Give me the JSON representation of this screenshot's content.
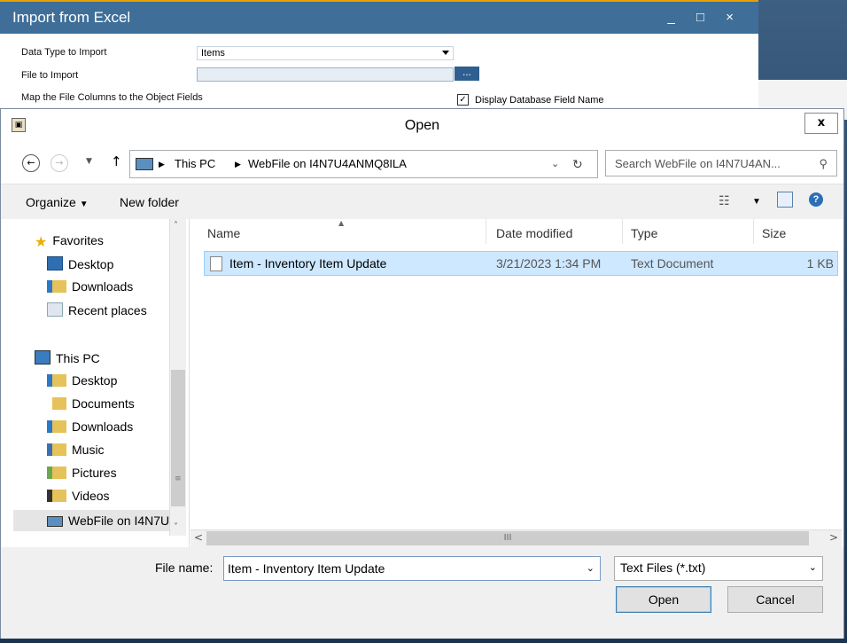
{
  "sap": {
    "title": "Import from Excel",
    "window_buttons": "_ □ ×",
    "data_type_label": "Data Type to Import",
    "data_type_value": "Items",
    "file_label": "File to Import",
    "browse_label": "...",
    "map_label": "Map the File Columns to the Object Fields",
    "display_db_label": "Display Database Field Name",
    "display_db_checked": true
  },
  "dialog": {
    "title": "Open",
    "close_label": "x",
    "breadcrumb": [
      "This PC",
      "WebFile on I4N7U4ANMQ8ILA"
    ],
    "search_placeholder": "Search WebFile on I4N7U4AN...",
    "toolbar": {
      "organize": "Organize",
      "new_folder": "New folder"
    },
    "sidebar": {
      "favorites": [
        {
          "label": "Favorites",
          "icon": "star-icon"
        },
        {
          "label": "Desktop",
          "icon": "desktop-icon"
        },
        {
          "label": "Downloads",
          "icon": "downloads-icon"
        },
        {
          "label": "Recent places",
          "icon": "recent-places-icon"
        }
      ],
      "this_pc": [
        {
          "label": "This PC",
          "icon": "computer-icon"
        },
        {
          "label": "Desktop",
          "icon": "desktop-folder-icon"
        },
        {
          "label": "Documents",
          "icon": "documents-icon"
        },
        {
          "label": "Downloads",
          "icon": "downloads-icon"
        },
        {
          "label": "Music",
          "icon": "music-icon"
        },
        {
          "label": "Pictures",
          "icon": "pictures-icon"
        },
        {
          "label": "Videos",
          "icon": "videos-icon"
        },
        {
          "label": "WebFile on I4N7U",
          "icon": "network-drive-icon"
        }
      ]
    },
    "columns": [
      "Name",
      "Date modified",
      "Type",
      "Size"
    ],
    "files": [
      {
        "name": "Item - Inventory Item Update",
        "date": "3/21/2023 1:34 PM",
        "type": "Text Document",
        "size": "1 KB"
      }
    ],
    "file_name_label": "File name:",
    "file_name_value": "Item - Inventory Item Update",
    "file_type_value": "Text Files (*.txt)",
    "open_label": "Open",
    "cancel_label": "Cancel",
    "scroll_grip": "III"
  }
}
